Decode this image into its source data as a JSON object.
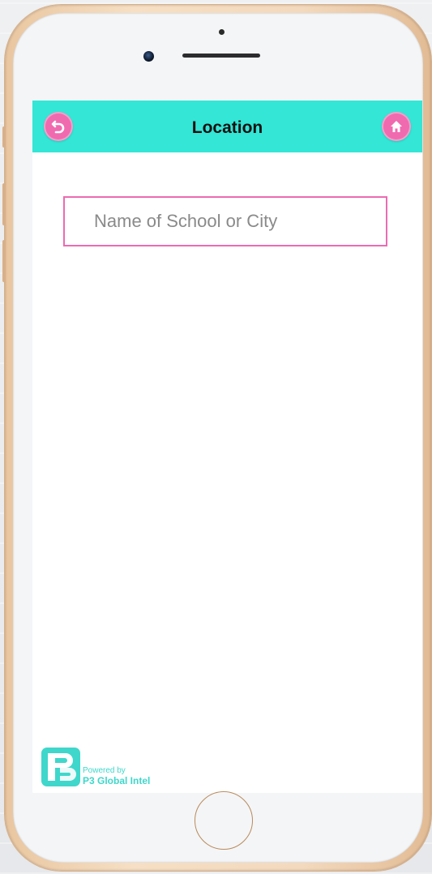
{
  "header": {
    "title": "Location",
    "back_icon": "undo-arrow-icon",
    "home_icon": "home-icon"
  },
  "search": {
    "placeholder": "Name of School or City",
    "value": ""
  },
  "branding": {
    "powered_by": "Powered by",
    "name": "P3 Global Intel",
    "logo_text": "P3"
  },
  "colors": {
    "header_bg": "#33e6d6",
    "button_pink": "#f06ab0",
    "input_border": "#ec6bb2",
    "brand_teal": "#3fd7cb",
    "phone_gold": "#f3d9bd"
  }
}
